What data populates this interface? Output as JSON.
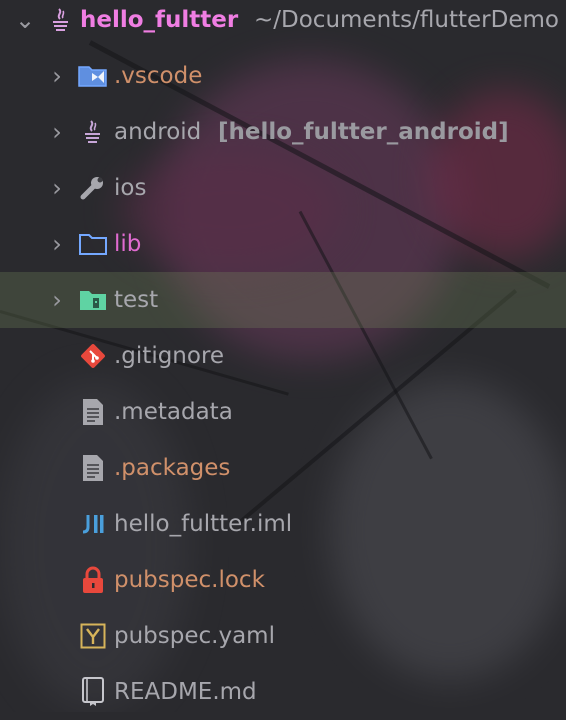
{
  "root": {
    "name": "hello_fultter",
    "path": "~/Documents/flutterDemo"
  },
  "items": [
    {
      "label": "vscode-folder",
      "name": ".vscode"
    },
    {
      "label": "android-module",
      "name": "android",
      "suffix": "[hello_fultter_android]"
    },
    {
      "label": "ios-folder",
      "name": "ios"
    },
    {
      "label": "lib-folder",
      "name": "lib"
    },
    {
      "label": "test-folder",
      "name": "test"
    },
    {
      "label": "gitignore-file",
      "name": ".gitignore"
    },
    {
      "label": "metadata-file",
      "name": ".metadata"
    },
    {
      "label": "packages-file",
      "name": ".packages"
    },
    {
      "label": "iml-file",
      "name": "hello_fultter.iml"
    },
    {
      "label": "lock-file",
      "name": "pubspec.lock"
    },
    {
      "label": "yaml-file",
      "name": "pubspec.yaml"
    },
    {
      "label": "readme-file",
      "name": "README.md"
    }
  ],
  "icons": {
    "root": "java-module-icon",
    "vscode": "vscode-folder-icon",
    "android": "java-module-icon",
    "ios": "wrench-icon",
    "lib": "folder-icon",
    "test": "test-folder-icon",
    "gitignore": "git-icon",
    "metadata": "text-file-icon",
    "packages": "text-file-icon",
    "iml": "intellij-module-icon",
    "lock": "lock-icon",
    "yaml": "yaml-icon",
    "readme": "markdown-icon"
  },
  "colors": {
    "root_name": "#f07ee3",
    "folder_blue": "#74a8ff",
    "test_green": "#5fd3a3",
    "git_red": "#e8483c",
    "lock_red": "#e8483c",
    "selection": "#768c5c"
  }
}
